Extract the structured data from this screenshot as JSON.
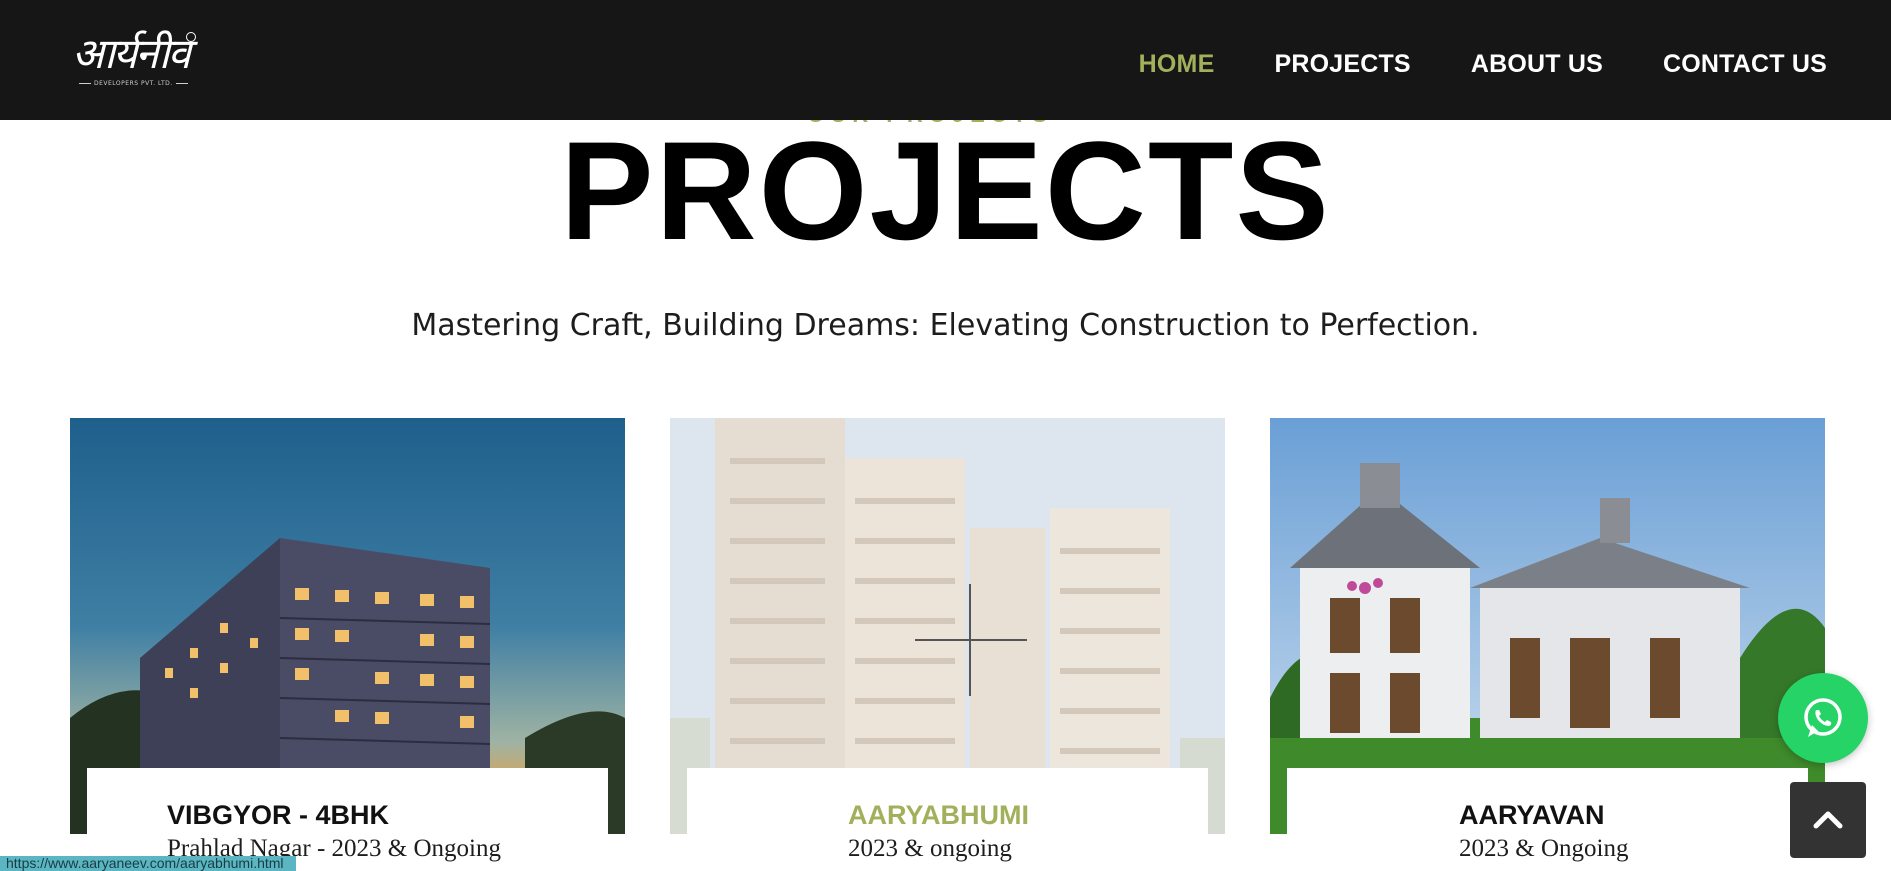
{
  "header": {
    "logo_text": "आर्यनीव",
    "logo_sub": "DEVELOPERS PVT. LTD.",
    "nav": [
      {
        "label": "HOME",
        "active": true
      },
      {
        "label": "PROJECTS",
        "active": false
      },
      {
        "label": "ABOUT US",
        "active": false
      },
      {
        "label": "CONTACT US",
        "active": false
      }
    ]
  },
  "section": {
    "title": "PROJECTS",
    "subtitle": "Mastering Craft, Building Dreams: Elevating Construction to Perfection."
  },
  "cards": [
    {
      "title": "VIBGYOR - 4BHK",
      "subtitle": "Prahlad Nagar - 2023 & Ongoing",
      "image": "tower-night-photo"
    },
    {
      "title": "AARYABHUMI",
      "subtitle": "2023 & ongoing",
      "image": "apartment-blocks-photo",
      "hovered": true
    },
    {
      "title": "AARYAVAN",
      "subtitle": "2023 & Ongoing",
      "image": "villa-lawn-photo"
    }
  ],
  "floating": {
    "whatsapp_icon": "whatsapp-icon",
    "back_to_top_icon": "chevron-up-icon"
  },
  "status_bar": {
    "url": "https://www.aaryaneev.com/aaryabhumi.html"
  },
  "colors": {
    "header_bg": "#161616",
    "accent": "#a1b05a",
    "whatsapp": "#25d366"
  }
}
